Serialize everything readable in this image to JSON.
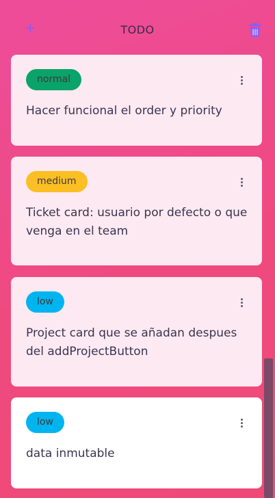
{
  "header": {
    "add_icon": "plus-icon",
    "title": "TODO",
    "trash_icon": "trash-icon",
    "icon_color": "#8b5cf6"
  },
  "cards": [
    {
      "tag": "normal",
      "tag_color": "#0aa36a",
      "text": "Hacer funcional el order y priority"
    },
    {
      "tag": "medium",
      "tag_color": "#fbbf24",
      "text": "Ticket card: usuario por defecto o que venga en el team"
    },
    {
      "tag": "low",
      "tag_color": "#00b4f0",
      "text": "Project card que se añadan despues del addProjectButton"
    },
    {
      "tag": "low",
      "tag_color": "#00b4f0",
      "text": "data inmutable"
    }
  ]
}
